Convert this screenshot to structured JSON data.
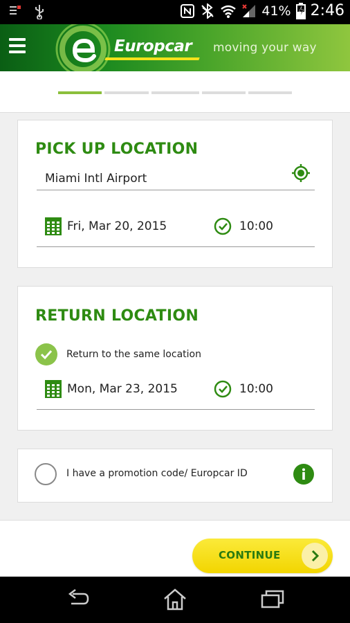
{
  "status_bar": {
    "battery": "41%",
    "time": "2:46"
  },
  "header": {
    "brand": "Europcar",
    "tagline": "moving your way"
  },
  "steps": {
    "total": 5,
    "active": 1
  },
  "pickup": {
    "title": "PICK UP LOCATION",
    "location": "Miami Intl Airport",
    "date": "Fri, Mar 20, 2015",
    "time": "10:00"
  },
  "return": {
    "title": "RETURN LOCATION",
    "same_location_label": "Return to the same location",
    "same_location_checked": true,
    "date": "Mon, Mar 23, 2015",
    "time": "10:00"
  },
  "promo": {
    "label": "I have a promotion code/ Europcar ID",
    "checked": false
  },
  "actions": {
    "continue_label": "CONTINUE"
  },
  "colors": {
    "brand_green": "#2e8b12",
    "accent_yellow": "#f2d500",
    "step_active": "#8bbf3c",
    "check_green": "#8bc34a"
  }
}
